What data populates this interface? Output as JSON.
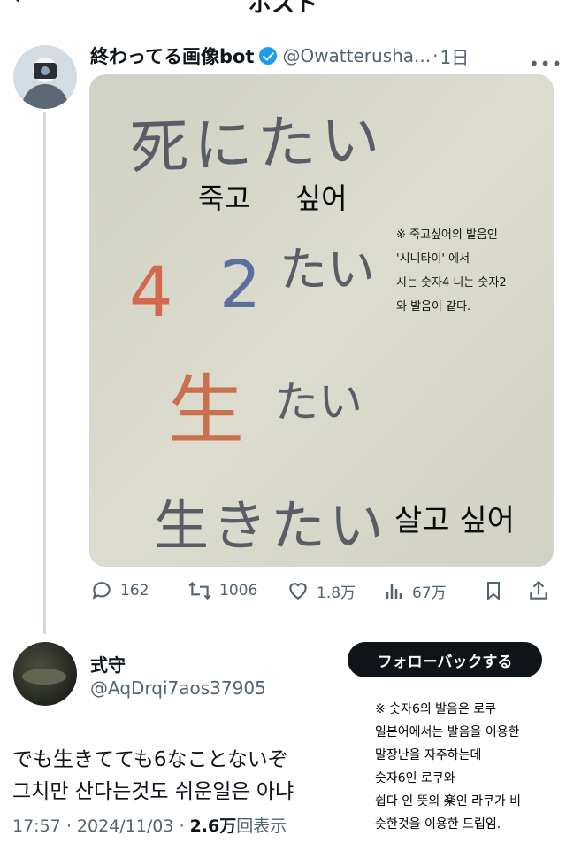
{
  "topbar": {
    "back": "‹",
    "title": "ポスト"
  },
  "post1": {
    "author_name": "終わってる画像bot",
    "handle": "@Owatterusha...",
    "separator": "·",
    "time": "1日",
    "more": "•••",
    "image": {
      "handwriting": {
        "line1": "死にたい",
        "line2_num4": "4",
        "line2_num2": "2",
        "line2_rest": "たい",
        "line3_kanji": "生",
        "line3_rest": "たい",
        "line4": "生きたい"
      },
      "overlay_line1": "죽고     싶어",
      "overlay_line4": "살고 싶어",
      "note": "※ 죽고싶어의 발음인\n '시니타이' 에서\n 시는 숫자4 니는 숫자2\n 와 발음이 같다."
    },
    "stats": {
      "replies": "162",
      "reposts": "1006",
      "likes": "1.8万",
      "views": "67万"
    },
    "icons": {
      "reply": "reply-icon",
      "repost": "repost-icon",
      "like": "heart-icon",
      "views": "views-icon",
      "bookmark": "bookmark-icon",
      "share": "share-icon"
    }
  },
  "post2": {
    "author_name": "式守",
    "handle": "@AqDrqi7aos37905",
    "follow_label": "フォローバックする",
    "text": "でも生きてても6なことないぞ\n그치만 산다는것도 쉬운일은 아냐",
    "time": "17:57",
    "date": "2024/11/03",
    "views_count": "2.6万",
    "views_label": "回表示",
    "separator": "·",
    "note": "※ 숫자6의 발음은 로쿠\n일본어에서는 발음을 이용한\n말장난을 자주하는데\n숫자6인 로쿠와\n쉽다 인 뜻의 楽인 라쿠가 비\n슷한것을 이용한 드립임."
  }
}
